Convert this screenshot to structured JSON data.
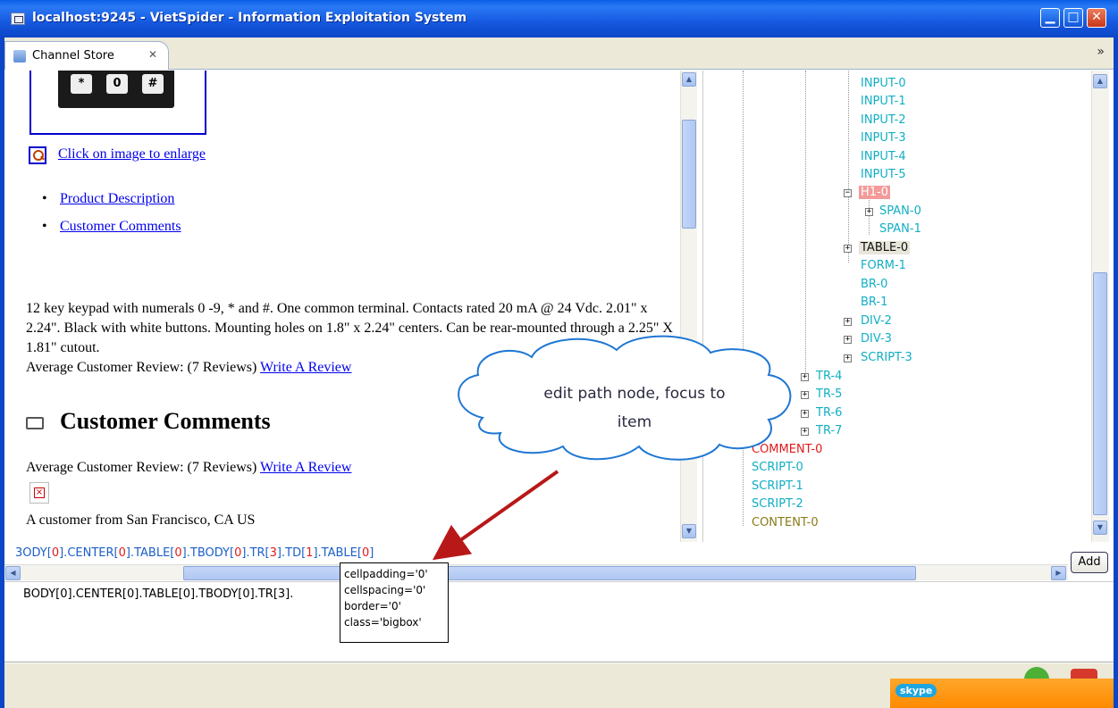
{
  "window": {
    "title": "localhost:9245 - VietSpider - Information Exploitation System",
    "minimize": "▁",
    "maximize": "□",
    "close": "✕"
  },
  "tab": {
    "label": "Channel Store",
    "close": "✕",
    "more": "»"
  },
  "browser": {
    "keys": [
      "*",
      "0",
      "#"
    ],
    "enlarge_link": "Click on image to enlarge",
    "links": [
      "Product Description",
      "Customer Comments"
    ],
    "description": "12 key keypad with numerals 0 -9, * and #. One common terminal. Contacts rated 20 mA @ 24 Vdc. 2.01\" x 2.24\". Black with white buttons. Mounting holes on 1.8\" x 2.24\" centers. Can be rear-mounted through a 2.25\" X 1.81\" cutout.",
    "avg_review": "Average Customer Review: (7 Reviews)",
    "write_review": "Write A Review",
    "heading": "Customer Comments",
    "avg_review_2": "Average Customer Review: (7 Reviews)",
    "write_review_2": "Write A Review",
    "customer_from": "A customer from San Francisco, CA US"
  },
  "tree": {
    "nodes": [
      {
        "label": "INPUT-0"
      },
      {
        "label": "INPUT-1"
      },
      {
        "label": "INPUT-2"
      },
      {
        "label": "INPUT-3"
      },
      {
        "label": "INPUT-4"
      },
      {
        "label": "INPUT-5"
      },
      {
        "label": "H1-0"
      },
      {
        "label": "SPAN-0"
      },
      {
        "label": "SPAN-1"
      },
      {
        "label": "TABLE-0"
      },
      {
        "label": "FORM-1"
      },
      {
        "label": "BR-0"
      },
      {
        "label": "BR-1"
      },
      {
        "label": "DIV-2"
      },
      {
        "label": "DIV-3"
      },
      {
        "label": "SCRIPT-3"
      },
      {
        "label": "TR-4"
      },
      {
        "label": "TR-5"
      },
      {
        "label": "TR-6"
      },
      {
        "label": "TR-7"
      },
      {
        "label": "COMMENT-0"
      },
      {
        "label": "SCRIPT-0"
      },
      {
        "label": "SCRIPT-1"
      },
      {
        "label": "SCRIPT-2"
      },
      {
        "label": "CONTENT-0"
      }
    ]
  },
  "path": {
    "segments": [
      {
        "name": "BODY",
        "idx": "0"
      },
      {
        "name": "CENTER",
        "idx": "0"
      },
      {
        "name": "TABLE",
        "idx": "0"
      },
      {
        "name": "TBODY",
        "idx": "0"
      },
      {
        "name": "TR",
        "idx": "3"
      },
      {
        "name": "TD",
        "idx": "1"
      },
      {
        "name": "TABLE",
        "idx": "0"
      }
    ],
    "first_visible": "3ODY",
    "add_label": "Add"
  },
  "result_line": "BODY[0].CENTER[0].TABLE[0].TBODY[0].TR[3].",
  "tooltip": [
    "cellpadding='0'",
    "cellspacing='0'",
    "border='0'",
    "class='bigbox'"
  ],
  "callout": {
    "line1": "edit path node, focus to",
    "line2": "item"
  },
  "skype_label": "skype",
  "colors": {
    "titlebar": "#0b46c7",
    "tree_cyan": "#11aec4",
    "tree_red": "#e31b1b",
    "path_blue": "#1b5fc7",
    "arrow": "#b81818",
    "skype": "#ff8a00"
  }
}
